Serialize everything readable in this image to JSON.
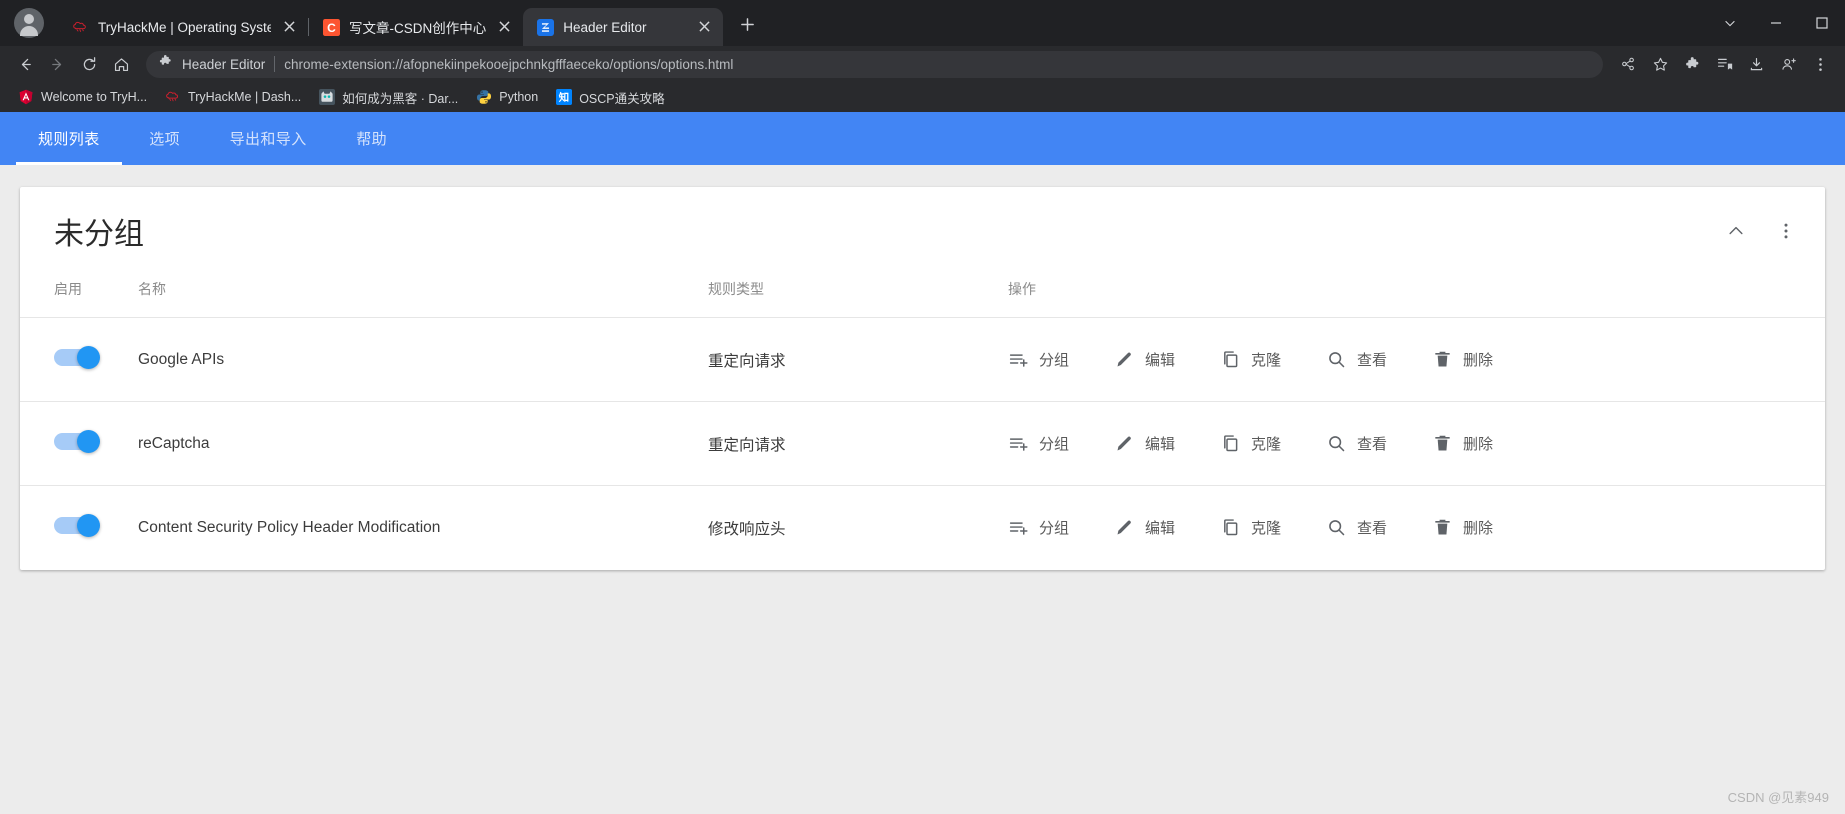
{
  "browser": {
    "tabs": [
      {
        "title": "TryHackMe | Operating System",
        "favicon": "tryhackme-icon",
        "active": false,
        "closable": true
      },
      {
        "title": "写文章-CSDN创作中心",
        "favicon": "csdn-icon",
        "active": false,
        "closable": true
      },
      {
        "title": "Header Editor",
        "favicon": "header-editor-icon",
        "active": true,
        "closable": true
      }
    ],
    "new_tab_label": "+",
    "window_controls": [
      "chevron-down-icon",
      "minimize-icon",
      "maximize-icon"
    ],
    "toolbar": {
      "back_icon": "back-arrow-icon",
      "forward_icon": "forward-arrow-icon",
      "reload_icon": "reload-icon",
      "home_icon": "home-icon",
      "extension_name": "Header Editor",
      "url": "chrome-extension://afopnekiinpekooejpchnkgfffaeceko/options/options.html",
      "right_icons": [
        "share-icon",
        "star-icon",
        "extensions-icon",
        "collections-icon",
        "downloads-icon",
        "profile-icon",
        "more-icon"
      ]
    },
    "bookmarks": [
      {
        "label": "Welcome to TryH...",
        "icon": "angular-icon",
        "color": "#dd0031",
        "glyph": "A"
      },
      {
        "label": "TryHackMe | Dash...",
        "icon": "tryhackme-icon",
        "color": "#202124",
        "glyph": ""
      },
      {
        "label": "如何成为黑客 · Dar...",
        "icon": "darkcat-icon",
        "color": "#3a4a55",
        "glyph": ""
      },
      {
        "label": "Python",
        "icon": "python-icon",
        "color": "#2b2b2b",
        "glyph": ""
      },
      {
        "label": "OSCP通关攻略",
        "icon": "zhihu-icon",
        "color": "#0084ff",
        "glyph": "知"
      }
    ]
  },
  "app": {
    "nav_tabs": [
      {
        "label": "规则列表",
        "active": true
      },
      {
        "label": "选项",
        "active": false
      },
      {
        "label": "导出和导入",
        "active": false
      },
      {
        "label": "帮助",
        "active": false
      }
    ],
    "accent_color": "#4285f4",
    "card": {
      "title": "未分组",
      "collapse_icon": "chevron-up-icon",
      "more_icon": "more-vertical-icon",
      "columns": [
        "启用",
        "名称",
        "规则类型",
        "操作"
      ],
      "rows": [
        {
          "enabled": true,
          "name": "Google APIs",
          "type": "重定向请求"
        },
        {
          "enabled": true,
          "name": "reCaptcha",
          "type": "重定向请求"
        },
        {
          "enabled": true,
          "name": "Content Security Policy Header Modification",
          "type": "修改响应头"
        }
      ],
      "operations": [
        {
          "label": "分组",
          "icon": "playlist-add-icon"
        },
        {
          "label": "编辑",
          "icon": "pencil-icon"
        },
        {
          "label": "克隆",
          "icon": "copy-icon"
        },
        {
          "label": "查看",
          "icon": "magnifier-icon"
        },
        {
          "label": "删除",
          "icon": "trash-icon"
        }
      ]
    }
  },
  "watermark": "CSDN @见素949"
}
